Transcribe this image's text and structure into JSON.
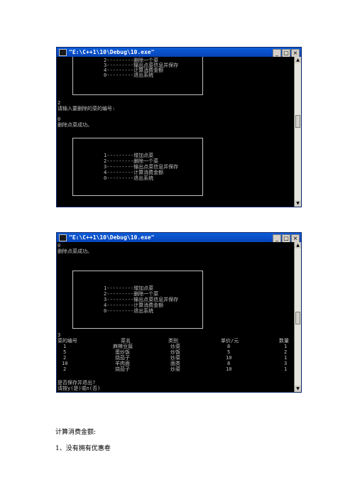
{
  "window1": {
    "title": "\"E:\\C++1\\10\\Debug\\10.exe\"",
    "controls": [
      "_",
      "□",
      "×"
    ],
    "menu_top": [
      "2---------删除一个菜",
      "3---------输出点菜信息并保存",
      "4---------计算消费金额",
      "0---------退出系统"
    ],
    "lines": [
      "2",
      "请输入要删除的菜的编号:",
      "0",
      "删除点菜成功。"
    ],
    "menu": [
      "1---------增加点菜",
      "2---------删除一个菜",
      "3---------输出点菜信息并保存",
      "4---------计算消费金额",
      "0---------退出系统"
    ]
  },
  "window2": {
    "title": "\"E:\\C++1\\10\\Debug\\10.exe\"",
    "controls": [
      "_",
      "□",
      "×"
    ],
    "lines_top": [
      "0",
      "删除点菜成功。"
    ],
    "menu": [
      "1---------增加点菜",
      "2---------删除一个菜",
      "3---------输出点菜信息并保存",
      "4---------计算消费金额",
      "0---------退出系统"
    ],
    "choice": "3",
    "table": {
      "headers": [
        "菜的编号",
        "菜名",
        "类别",
        "单价/元",
        "数量"
      ],
      "rows": [
        [
          "1",
          "麻辣豆腐",
          "炒菜",
          "8",
          "1"
        ],
        [
          "5",
          "蛋炒饭",
          "炒饭",
          "5",
          "2"
        ],
        [
          "2",
          "烧茄子",
          "炒菜",
          "10",
          "1"
        ],
        [
          "10",
          "羊肉面",
          "面类",
          "8",
          "3"
        ],
        [
          "2",
          "烧茄子",
          "炒菜",
          "10",
          "1"
        ]
      ]
    },
    "prompt": [
      "是否保存并退出?",
      "请按y(是)或n(否)"
    ]
  },
  "doc": {
    "line1": "计算消费金额:",
    "line2": "1、没有拥有优惠卷"
  }
}
